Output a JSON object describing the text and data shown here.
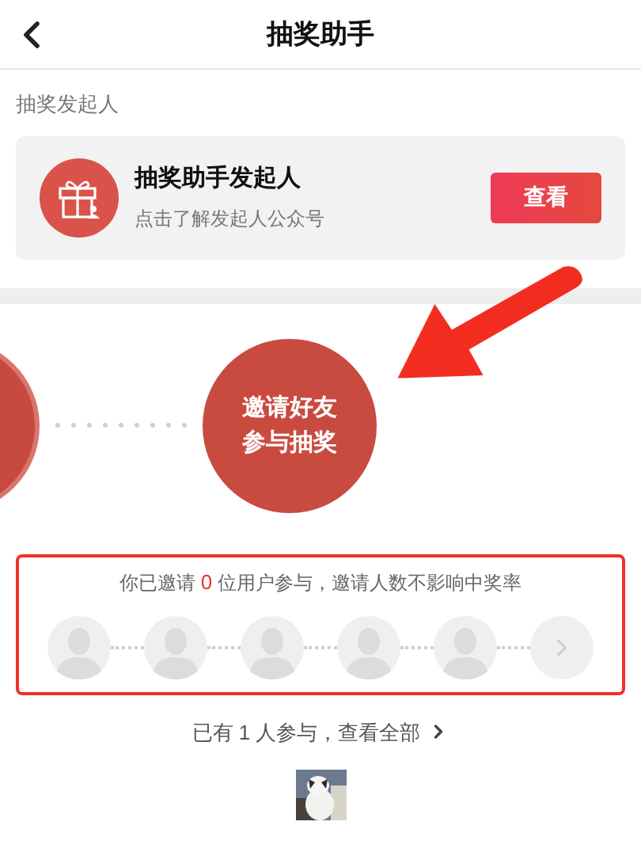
{
  "header": {
    "title": "抽奖助手"
  },
  "organizer": {
    "section_label": "抽奖发起人",
    "name": "抽奖助手发起人",
    "subtitle": "点击了解发起人公众号",
    "button": "查看"
  },
  "steps": {
    "current": [
      "邀请好友",
      "参与抽奖"
    ]
  },
  "invite": {
    "before": "你已邀请 ",
    "count": "0",
    "after": " 位用户参与，邀请人数不影响中奖率",
    "slots": [
      {
        "filled": false
      },
      {
        "filled": false
      },
      {
        "filled": false
      },
      {
        "filled": false
      },
      {
        "filled": false
      }
    ]
  },
  "participants": {
    "text": "已有 1 人参与，查看全部"
  },
  "annotation": {
    "highlight": true
  }
}
